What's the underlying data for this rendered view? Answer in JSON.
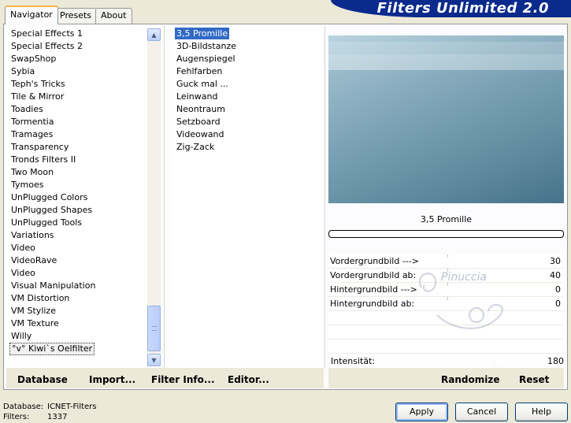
{
  "header": {
    "app_title": "Filters Unlimited 2.0",
    "tabs": [
      "Navigator",
      "Presets",
      "About"
    ],
    "active_tab": "Navigator"
  },
  "categories": {
    "items": [
      "Special Effects 1",
      "Special Effects 2",
      "SwapShop",
      "Sybia",
      "Teph's Tricks",
      "Tile & Mirror",
      "Toadies",
      "Tormentia",
      "Tramages",
      "Transparency",
      "Tronds Filters II",
      "Two Moon",
      "Tymoes",
      "UnPlugged Colors",
      "UnPlugged Shapes",
      "UnPlugged Tools",
      "Variations",
      "Video",
      "VideoRave",
      "Video",
      "Visual Manipulation",
      "VM Distortion",
      "VM Stylize",
      "VM Texture",
      "Willy",
      "°v° Kiwi`s Oelfilter"
    ],
    "selected": "°v° Kiwi`s Oelfilter"
  },
  "filters": {
    "items": [
      "3,5 Promille",
      "3D-Bildstanze",
      "Augenspiegel",
      "Fehlfarben",
      "Guck mal ...",
      "Leinwand",
      "Neontraum",
      "Setzboard",
      "Videowand",
      "Zig-Zack"
    ],
    "selected": "3,5 Promille"
  },
  "preview": {
    "filter_name": "3,5 Promille",
    "progress": 0
  },
  "parameters": [
    {
      "label": "Vordergrundbild --->",
      "value": "30"
    },
    {
      "label": "Vordergrundbild ab:",
      "value": "40"
    },
    {
      "label": "Hintergrundbild --->",
      "value": "0"
    },
    {
      "label": "Hintergrundbild ab:",
      "value": "0"
    }
  ],
  "intensity": {
    "label": "Intensität:",
    "value": "180"
  },
  "watermark": {
    "text": "Pinuccia"
  },
  "toolbar": {
    "database": "Database",
    "import": "Import...",
    "filter_info": "Filter Info...",
    "editor": "Editor...",
    "randomize": "Randomize",
    "reset": "Reset"
  },
  "footer": {
    "database_label": "Database:",
    "database_value": "ICNET-Filters",
    "filters_label": "Filters:",
    "filters_value": "1337"
  },
  "dialog_buttons": {
    "apply": "Apply",
    "cancel": "Cancel",
    "help": "Help"
  },
  "colors": {
    "brand_blue": "#0a2a8c",
    "selection_blue": "#316ac5",
    "panel_bg": "#ece9d8",
    "tab_accent": "#f2b53b"
  },
  "icons": [
    "chevron-up-icon",
    "chevron-down-icon",
    "scroll-grip-icon"
  ]
}
